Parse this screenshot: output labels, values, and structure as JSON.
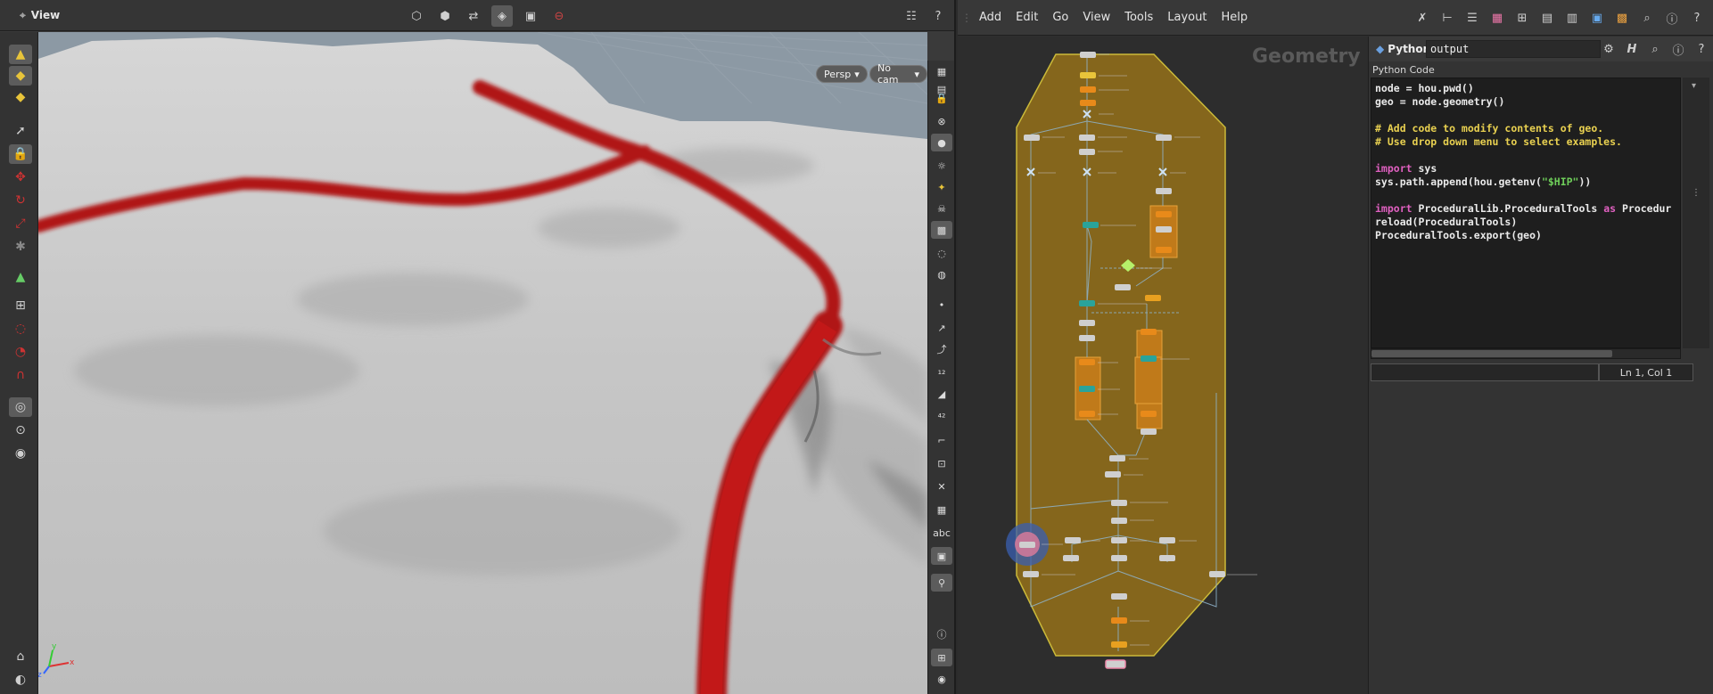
{
  "viewport": {
    "title": "View",
    "persp_label": "Persp",
    "cam_label": "No cam",
    "axis_labels": {
      "x": "x",
      "y": "y",
      "z": "z"
    }
  },
  "network": {
    "menu": [
      "Add",
      "Edit",
      "Go",
      "View",
      "Tools",
      "Layout",
      "Help"
    ],
    "context_label": "Geometry"
  },
  "python_panel": {
    "type_label": "Python",
    "node_name": "output",
    "code_label": "Python Code",
    "code_lines": [
      [
        {
          "t": "node = hou.pwd()",
          "c": ""
        }
      ],
      [
        {
          "t": "geo = node.geometry()",
          "c": ""
        }
      ],
      [
        {
          "t": "",
          "c": ""
        }
      ],
      [
        {
          "t": "# Add code to modify contents of geo.",
          "c": "cm"
        }
      ],
      [
        {
          "t": "# Use drop down menu to select examples.",
          "c": "cm"
        }
      ],
      [
        {
          "t": "",
          "c": ""
        }
      ],
      [
        {
          "t": "import",
          "c": "kw"
        },
        {
          "t": " sys",
          "c": ""
        }
      ],
      [
        {
          "t": "sys.path.append(hou.getenv(",
          "c": ""
        },
        {
          "t": "\"$HIP\"",
          "c": "st"
        },
        {
          "t": "))",
          "c": ""
        }
      ],
      [
        {
          "t": "",
          "c": ""
        }
      ],
      [
        {
          "t": "import",
          "c": "kw"
        },
        {
          "t": " ProceduralLib.ProceduralTools ",
          "c": ""
        },
        {
          "t": "as",
          "c": "kw"
        },
        {
          "t": " Procedur",
          "c": ""
        }
      ],
      [
        {
          "t": "reload(ProceduralTools)",
          "c": ""
        }
      ],
      [
        {
          "t": "ProceduralTools.export(geo)",
          "c": ""
        }
      ]
    ],
    "cursor_status": "Ln 1, Col 1"
  },
  "colors": {
    "road": "#b81414",
    "terrain": "#c4c4c4",
    "sky": "#8a98a4",
    "network_box": "#8a6a1c",
    "network_border": "#d4c23a"
  }
}
